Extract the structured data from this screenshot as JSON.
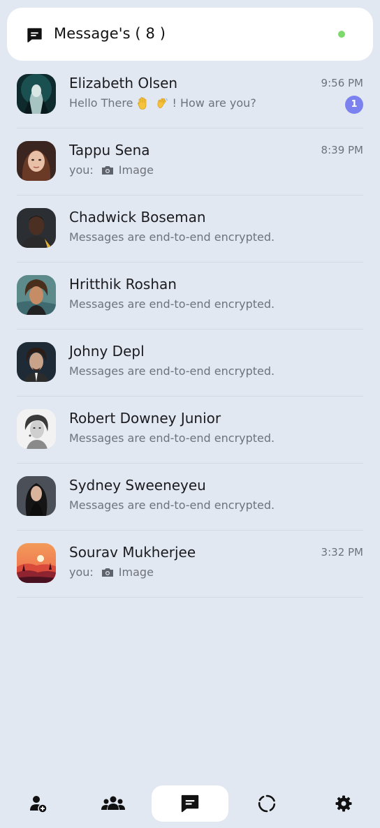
{
  "header": {
    "title": "Message's ( 8 )",
    "icon": "chat-icon",
    "status": "online",
    "status_color": "#7ed96d"
  },
  "chats": [
    {
      "name": "Elizabeth Olsen",
      "preview_before": "Hello There",
      "preview_after": "! How are you?",
      "emojis": [
        "raised-hand",
        "waving-hand"
      ],
      "time": "9:56 PM",
      "unread": "1"
    },
    {
      "name": "Tappu Sena",
      "preview_prefix": "you:",
      "preview_media": "Image",
      "time": "8:39 PM"
    },
    {
      "name": "Chadwick Boseman",
      "preview": "Messages are end-to-end encrypted."
    },
    {
      "name": "Hritthik Roshan",
      "preview": "Messages are end-to-end encrypted."
    },
    {
      "name": "Johny Depl",
      "preview": "Messages are end-to-end encrypted."
    },
    {
      "name": "Robert Downey Junior",
      "preview": "Messages are end-to-end encrypted."
    },
    {
      "name": "Sydney Sweeneyeu",
      "preview": "Messages are end-to-end encrypted."
    },
    {
      "name": "Sourav Mukherjee",
      "preview_prefix": "you:",
      "preview_media": "Image",
      "time": "3:32 PM"
    }
  ],
  "nav": [
    {
      "icon": "add-user-icon",
      "active": false
    },
    {
      "icon": "groups-icon",
      "active": false
    },
    {
      "icon": "chat-icon",
      "active": true
    },
    {
      "icon": "status-icon",
      "active": false
    },
    {
      "icon": "settings-icon",
      "active": false
    }
  ],
  "colors": {
    "background": "#e2e8f1",
    "badge": "#7b82f0",
    "card": "#ffffff"
  }
}
